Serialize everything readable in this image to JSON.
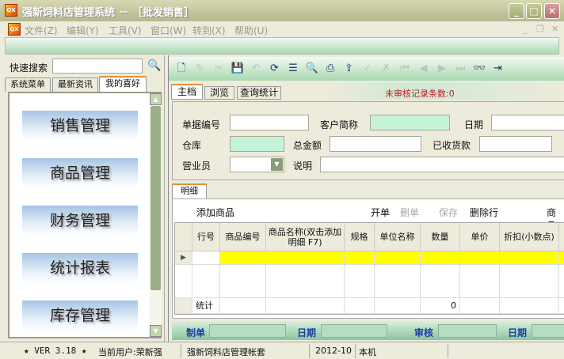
{
  "window": {
    "title": "强新饲料店管理系统 － ［批发销售］",
    "logo": "QX"
  },
  "menu": [
    "文件(Z)",
    "编辑(Y)",
    "工具(V)",
    "窗口(W)",
    "转到(X)",
    "帮助(U)"
  ],
  "left": {
    "search_label": "快速搜索",
    "search_value": "",
    "tabs": [
      "系统菜单",
      "最新资讯",
      "我的喜好"
    ],
    "nav": [
      "销售管理",
      "商品管理",
      "财务管理",
      "统计报表",
      "库存管理"
    ]
  },
  "toolbar_icons": [
    "new-icon",
    "edit-icon",
    "delete-icon",
    "save-icon",
    "undo-icon",
    "refresh-icon",
    "list-icon",
    "preview-icon",
    "print-icon",
    "export-icon",
    "audit-icon",
    "unaudit-icon",
    "first-icon",
    "prev-icon",
    "next-icon",
    "last-icon",
    "find-icon",
    "exit-icon"
  ],
  "tabs": [
    "主档",
    "浏览",
    "查询统计"
  ],
  "unaudited": "未审核记录条数:0",
  "form": {
    "bill_no": "单据编号",
    "customer": "客户简称",
    "date": "日期",
    "warehouse": "仓库",
    "total": "总金额",
    "received": "已收货款",
    "salesman": "营业员",
    "note": "说明"
  },
  "detail": {
    "tab": "明细",
    "add": "添加商品",
    "open": "开单",
    "delete_bill": "删单",
    "save": "保存",
    "delete_row": "删除行",
    "goods": "商品",
    "columns": [
      "行号",
      "商品编号",
      "商品名称(双击添加明细 F7)",
      "规格",
      "单位名称",
      "数量",
      "单价",
      "折扣(小数点)"
    ],
    "stats_label": "统计",
    "stats_qty": "0"
  },
  "footer": {
    "maker": "制单",
    "date1": "日期",
    "auditor": "审核",
    "date2": "日期"
  },
  "status": {
    "version": "★ VER 3.18 ★",
    "user": "当前用户:荣新强",
    "account": "强新饲料店管理帐套",
    "period": "2012-10",
    "host": "本机"
  }
}
